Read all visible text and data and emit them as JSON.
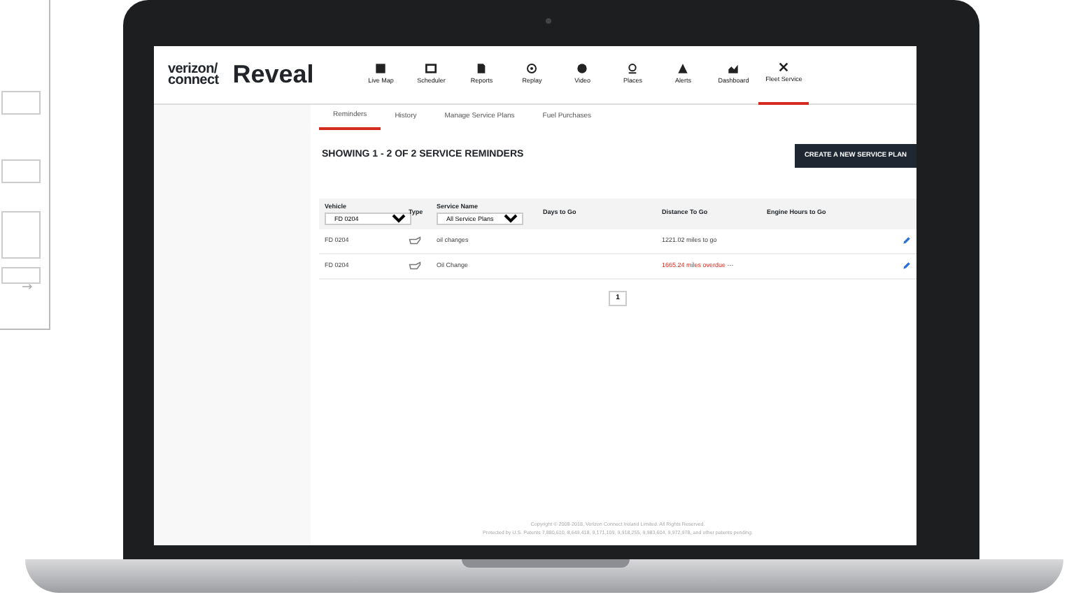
{
  "side_form": {
    "fields": [
      {
        "kind": "line"
      },
      {
        "kind": "line"
      },
      {
        "kind": "area"
      }
    ]
  },
  "app": {
    "logo": {
      "line_1": "verizon/",
      "line_2": "connect"
    },
    "product": "Reveal",
    "nav": [
      {
        "label": "Live Map",
        "selected": false
      },
      {
        "label": "Scheduler",
        "selected": false
      },
      {
        "label": "Reports",
        "selected": false
      },
      {
        "label": "Replay",
        "selected": false
      },
      {
        "label": "Video",
        "selected": false
      },
      {
        "label": "Places",
        "selected": false
      },
      {
        "label": "Alerts",
        "selected": false
      },
      {
        "label": "Dashboard",
        "selected": false
      },
      {
        "label": "Fleet Service",
        "selected": true
      }
    ],
    "tabs": [
      {
        "label": "Reminders",
        "selected": true
      },
      {
        "label": "History",
        "selected": false
      },
      {
        "label": "Manage Service Plans",
        "selected": false
      },
      {
        "label": "Fuel Purchases",
        "selected": false
      }
    ],
    "heading": "SHOWING 1 - 2 OF 2 SERVICE REMINDERS",
    "create_button": "CREATE A NEW SERVICE PLAN",
    "table": {
      "columns": [
        "Vehicle",
        "Type",
        "Service Name",
        "Days to Go",
        "Distance To Go",
        "Engine Hours to Go"
      ],
      "vehicle_filter": "FD 0204",
      "service_filter": "All Service Plans",
      "rows": [
        {
          "vehicle": "FD 0204",
          "service": "oil changes",
          "distance": "1221.02 miles to go",
          "overdue": false
        },
        {
          "vehicle": "FD 0204",
          "service": "Oil Change",
          "distance": "1665.24 miles overdue",
          "overdue": true,
          "extra": "---"
        }
      ]
    },
    "pages": [
      {
        "label": "1",
        "selected": true
      }
    ],
    "footer": [
      "Copyright © 2008-2018, Verizon Connect Ireland Limited. All Rights Reserved.",
      "Protected by U.S. Patents 7,880,610, 8,649,418, 9,171,109, 9,918,255, 9,983,604, 9,972,978, and other patents pending."
    ]
  }
}
